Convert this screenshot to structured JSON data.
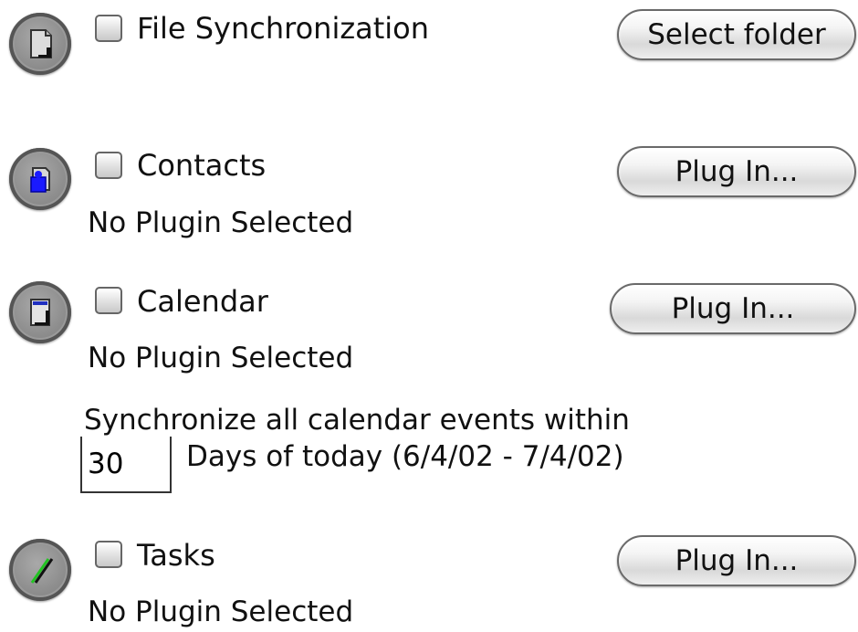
{
  "sections": [
    {
      "title": "File Synchronization",
      "button": "Select folder",
      "icon": "document-icon"
    },
    {
      "title": "Contacts",
      "status": "No Plugin Selected",
      "button": "Plug In...",
      "icon": "contacts-icon"
    },
    {
      "title": "Calendar",
      "status": "No Plugin Selected",
      "button": "Plug In...",
      "icon": "calendar-icon",
      "sync_text": "Synchronize all calendar events within",
      "days_value": "30",
      "days_text": "Days of today  (6/4/02 - 7/4/02)"
    },
    {
      "title": "Tasks",
      "status": "No Plugin Selected",
      "button": "Plug In...",
      "icon": "tasks-icon"
    }
  ],
  "colors": {
    "contacts_accent": "#1a1aff",
    "calendar_accent": "#2030c0",
    "tasks_accent": "#22c322"
  }
}
